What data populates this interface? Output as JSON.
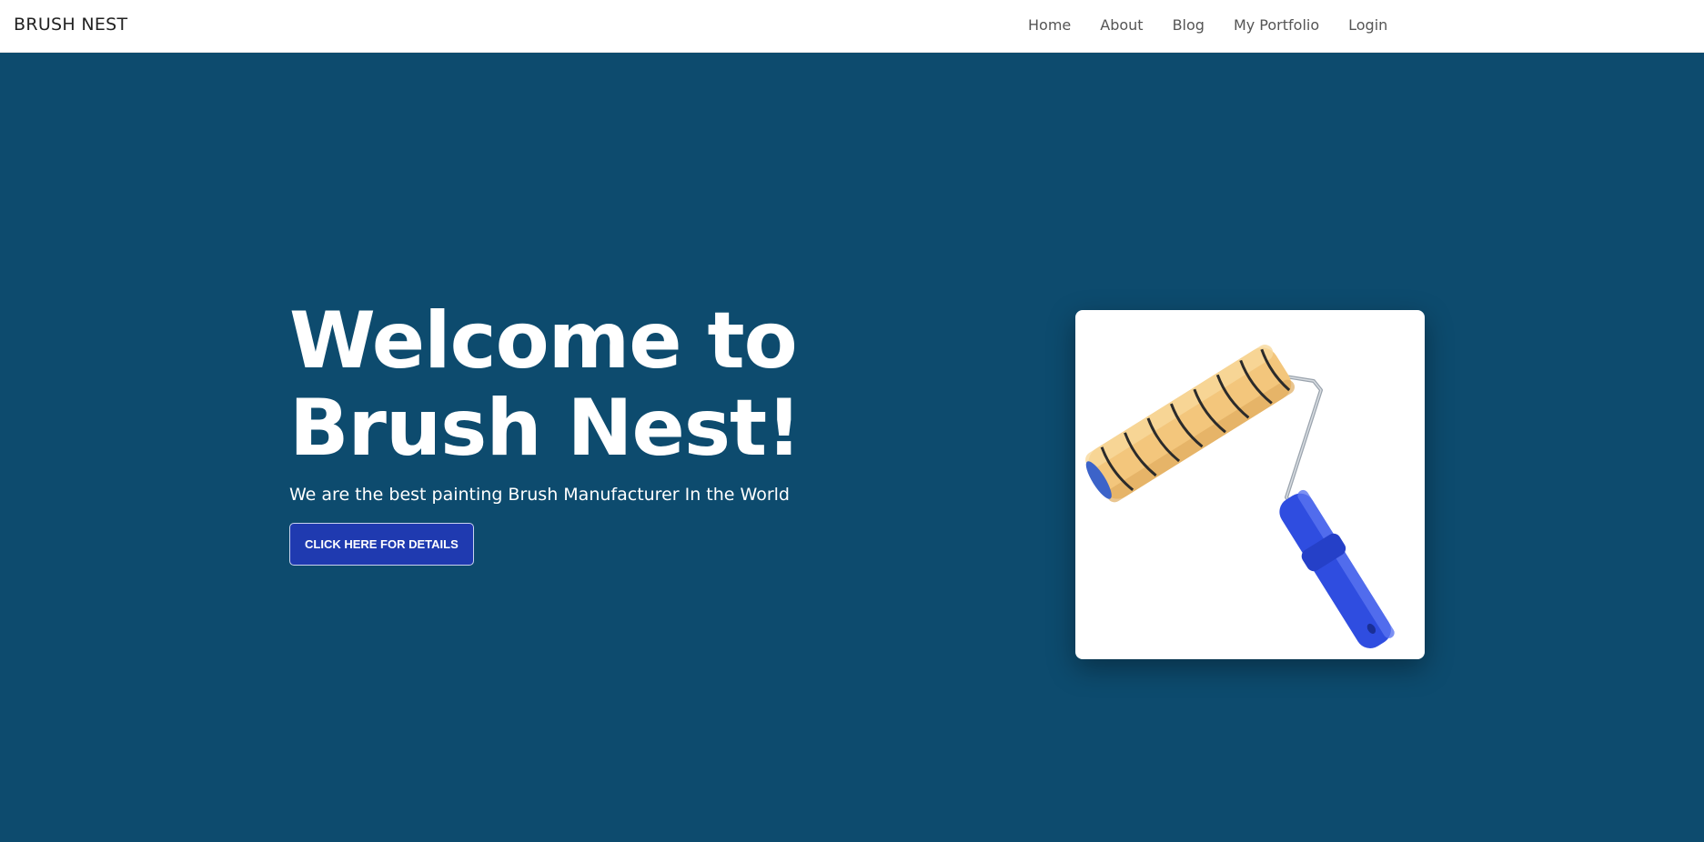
{
  "navbar": {
    "brand": "BRUSH NEST",
    "links": [
      {
        "label": "Home"
      },
      {
        "label": "About"
      },
      {
        "label": "Blog"
      },
      {
        "label": "My Portfolio"
      },
      {
        "label": "Login"
      }
    ]
  },
  "hero": {
    "title": "Welcome to Brush Nest!",
    "subtitle": "We are the best painting Brush Manufacturer In the World",
    "button_label": "CLICK HERE FOR DETAILS",
    "image_icon": "paint-roller-image"
  },
  "colors": {
    "hero_background": "#0d4b6e",
    "navbar_background": "#ffffff",
    "button_background": "#1f3ab0",
    "roller_handle": "#2f4de0",
    "roller_cover": "#f5c97e"
  }
}
